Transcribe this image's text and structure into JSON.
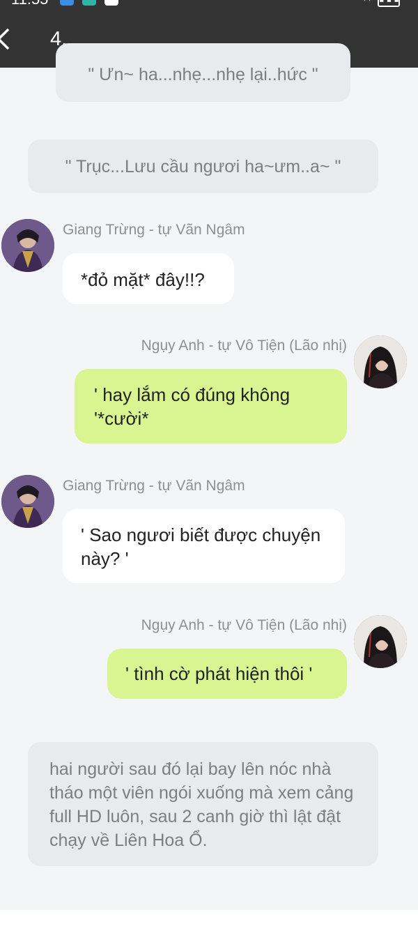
{
  "status_bar": {
    "time": "11:55"
  },
  "header": {
    "title": "4."
  },
  "messages": [
    {
      "type": "narration",
      "text": "\" Ưn~ ha...nhẹ...nhẹ lại..hức \""
    },
    {
      "type": "narration",
      "text": "\" Trục...Lưu cầu ngươi ha~ưm..a~ \""
    },
    {
      "type": "chat",
      "side": "left",
      "sender": "Giang Trừng - tự Vãn Ngâm",
      "text": "*đỏ mặt* đây!!?"
    },
    {
      "type": "chat",
      "side": "right",
      "sender": "Ngụy Anh - tự Vô Tiện (Lão nhị)",
      "text": "' hay lắm có đúng không '*cười*"
    },
    {
      "type": "chat",
      "side": "left",
      "sender": "Giang Trừng - tự Vãn Ngâm",
      "text": "' Sao ngươi biết được chuyện này? '"
    },
    {
      "type": "chat",
      "side": "right",
      "sender": "Ngụy Anh - tự Vô Tiện (Lão nhị)",
      "text": "' tình cờ phát hiện thôi '"
    },
    {
      "type": "narration",
      "text": "hai người sau đó lại bay lên nóc nhà tháo một viên ngói xuống mà xem cảng full HD luôn, sau 2 canh giờ thì lật đật chạy về Liên Hoa Ổ."
    }
  ],
  "colors": {
    "header_bg": "#333333",
    "page_bg": "#f4f5f7",
    "right_bubble": "#d8f591",
    "left_bubble": "#ffffff",
    "narration_bg": "#e9eaed"
  }
}
